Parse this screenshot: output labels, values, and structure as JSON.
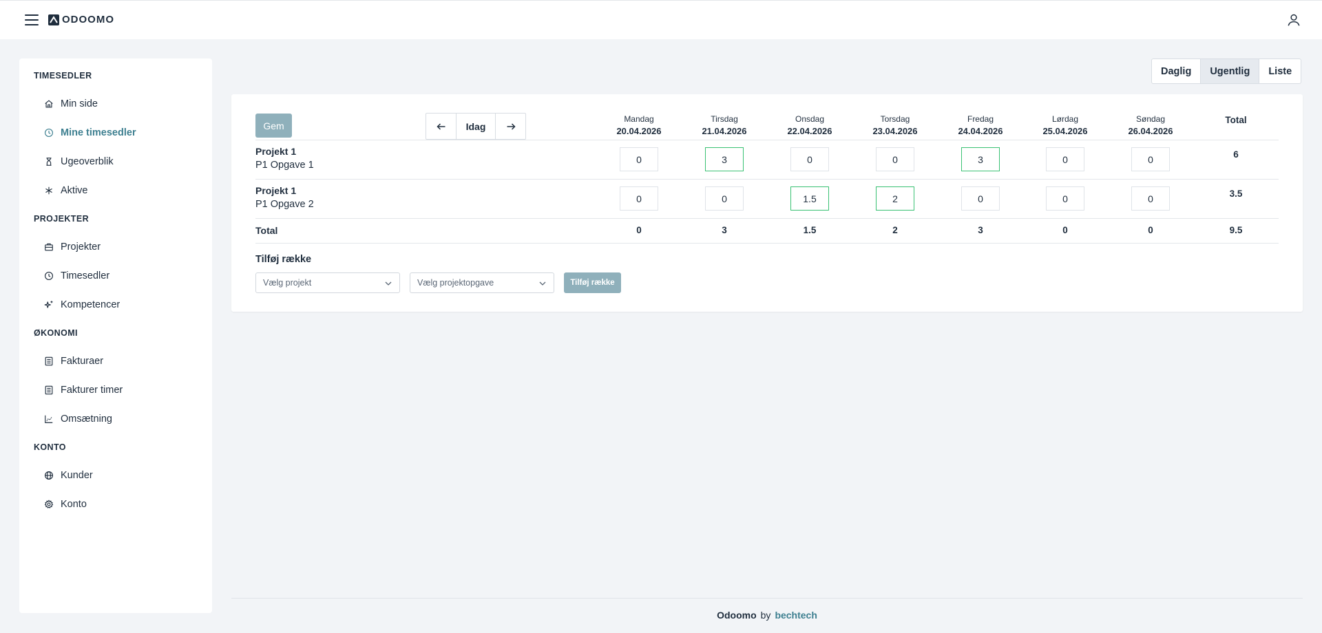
{
  "header": {
    "app_name": "ODOOMO"
  },
  "sidebar": {
    "sections": [
      {
        "title": "TIMESEDLER",
        "items": [
          {
            "label": "Min side",
            "icon": "home-icon"
          },
          {
            "label": "Mine timesedler",
            "icon": "clock-icon",
            "active": true
          },
          {
            "label": "Ugeoverblik",
            "icon": "hourglass-icon"
          },
          {
            "label": "Aktive",
            "icon": "asterisk-icon"
          }
        ]
      },
      {
        "title": "PROJEKTER",
        "items": [
          {
            "label": "Projekter",
            "icon": "briefcase-icon"
          },
          {
            "label": "Timesedler",
            "icon": "clock-icon"
          },
          {
            "label": "Kompetencer",
            "icon": "sparkles-icon"
          }
        ]
      },
      {
        "title": "ØKONOMI",
        "items": [
          {
            "label": "Fakturaer",
            "icon": "document-icon"
          },
          {
            "label": "Fakturer timer",
            "icon": "document-icon"
          },
          {
            "label": "Omsætning",
            "icon": "chart-icon"
          }
        ]
      },
      {
        "title": "KONTO",
        "items": [
          {
            "label": "Kunder",
            "icon": "globe-icon"
          },
          {
            "label": "Konto",
            "icon": "gear-icon"
          }
        ]
      }
    ]
  },
  "view_switch": {
    "daily": "Daglig",
    "weekly": "Ugentlig",
    "list": "Liste",
    "active": "Ugentlig"
  },
  "timesheet": {
    "save_label": "Gem",
    "today_label": "Idag",
    "days": [
      {
        "name": "Mandag",
        "date": "20.04.2026"
      },
      {
        "name": "Tirsdag",
        "date": "21.04.2026"
      },
      {
        "name": "Onsdag",
        "date": "22.04.2026"
      },
      {
        "name": "Torsdag",
        "date": "23.04.2026"
      },
      {
        "name": "Fredag",
        "date": "24.04.2026"
      },
      {
        "name": "Lørdag",
        "date": "25.04.2026"
      },
      {
        "name": "Søndag",
        "date": "26.04.2026"
      }
    ],
    "total_header": "Total",
    "rows": [
      {
        "project": "Projekt 1",
        "task": "P1 Opgave 1",
        "hours": [
          "0",
          "3",
          "0",
          "0",
          "3",
          "0",
          "0"
        ],
        "total": "6"
      },
      {
        "project": "Projekt 1",
        "task": "P1 Opgave 2",
        "hours": [
          "0",
          "0",
          "1.5",
          "2",
          "0",
          "0",
          "0"
        ],
        "total": "3.5"
      }
    ],
    "footer": {
      "label": "Total",
      "totals": [
        "0",
        "3",
        "1.5",
        "2",
        "3",
        "0",
        "0"
      ],
      "grand_total": "9.5"
    },
    "add_row": {
      "title": "Tilføj række",
      "project_placeholder": "Vælg projekt",
      "task_placeholder": "Vælg projektopgave",
      "button_label": "Tilføj række"
    }
  },
  "footer": {
    "brand": "Odoomo",
    "by": "by",
    "company": "bechtech"
  },
  "colors": {
    "accent": "#3d7f90",
    "filled_border": "#38c172",
    "button_bg": "#8fb0bb"
  }
}
